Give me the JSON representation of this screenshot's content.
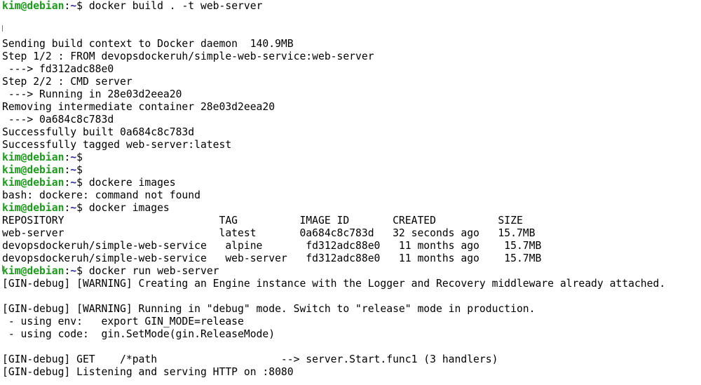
{
  "prompt": {
    "user_host": "kim@debian",
    "colon": ":",
    "cwd": "~",
    "symbol": "$ "
  },
  "lines": [
    {
      "type": "prompt",
      "command": "docker build . -t web-server"
    },
    {
      "type": "output",
      "text": ""
    },
    {
      "type": "output",
      "text": ""
    },
    {
      "type": "output",
      "text": "Sending build context to Docker daemon  140.9MB"
    },
    {
      "type": "output",
      "text": "Step 1/2 : FROM devopsdockeruh/simple-web-service:web-server"
    },
    {
      "type": "output",
      "text": " ---> fd312adc88e0"
    },
    {
      "type": "output",
      "text": "Step 2/2 : CMD server"
    },
    {
      "type": "output",
      "text": " ---> Running in 28e03d2eea20"
    },
    {
      "type": "output",
      "text": "Removing intermediate container 28e03d2eea20"
    },
    {
      "type": "output",
      "text": " ---> 0a684c8c783d"
    },
    {
      "type": "output",
      "text": "Successfully built 0a684c8c783d"
    },
    {
      "type": "output",
      "text": "Successfully tagged web-server:latest"
    },
    {
      "type": "prompt",
      "command": ""
    },
    {
      "type": "prompt",
      "command": ""
    },
    {
      "type": "prompt",
      "command": "dockere images"
    },
    {
      "type": "output",
      "text": "bash: dockere: command not found"
    },
    {
      "type": "prompt",
      "command": "docker images"
    },
    {
      "type": "output",
      "text": "REPOSITORY                         TAG          IMAGE ID       CREATED          SIZE"
    },
    {
      "type": "output",
      "text": "web-server                         latest       0a684c8c783d   32 seconds ago   15.7MB"
    },
    {
      "type": "output",
      "text": "devopsdockeruh/simple-web-service   alpine       fd312adc88e0   11 months ago    15.7MB"
    },
    {
      "type": "output",
      "text": "devopsdockeruh/simple-web-service   web-server   fd312adc88e0   11 months ago    15.7MB"
    },
    {
      "type": "prompt",
      "command": "docker run web-server"
    },
    {
      "type": "output",
      "text": "[GIN-debug] [WARNING] Creating an Engine instance with the Logger and Recovery middleware already attached."
    },
    {
      "type": "output",
      "text": ""
    },
    {
      "type": "output",
      "text": "[GIN-debug] [WARNING] Running in \"debug\" mode. Switch to \"release\" mode in production."
    },
    {
      "type": "output",
      "text": " - using env:   export GIN_MODE=release"
    },
    {
      "type": "output",
      "text": " - using code:  gin.SetMode(gin.ReleaseMode)"
    },
    {
      "type": "output",
      "text": ""
    },
    {
      "type": "output",
      "text": "[GIN-debug] GET    /*path                    --> server.Start.func1 (3 handlers)"
    },
    {
      "type": "output",
      "text": "[GIN-debug] Listening and serving HTTP on :8080"
    }
  ],
  "colors": {
    "background": "#ffffff",
    "text": "#000000",
    "user_host": "#1a9b1a",
    "cwd": "#2a2aa8"
  }
}
